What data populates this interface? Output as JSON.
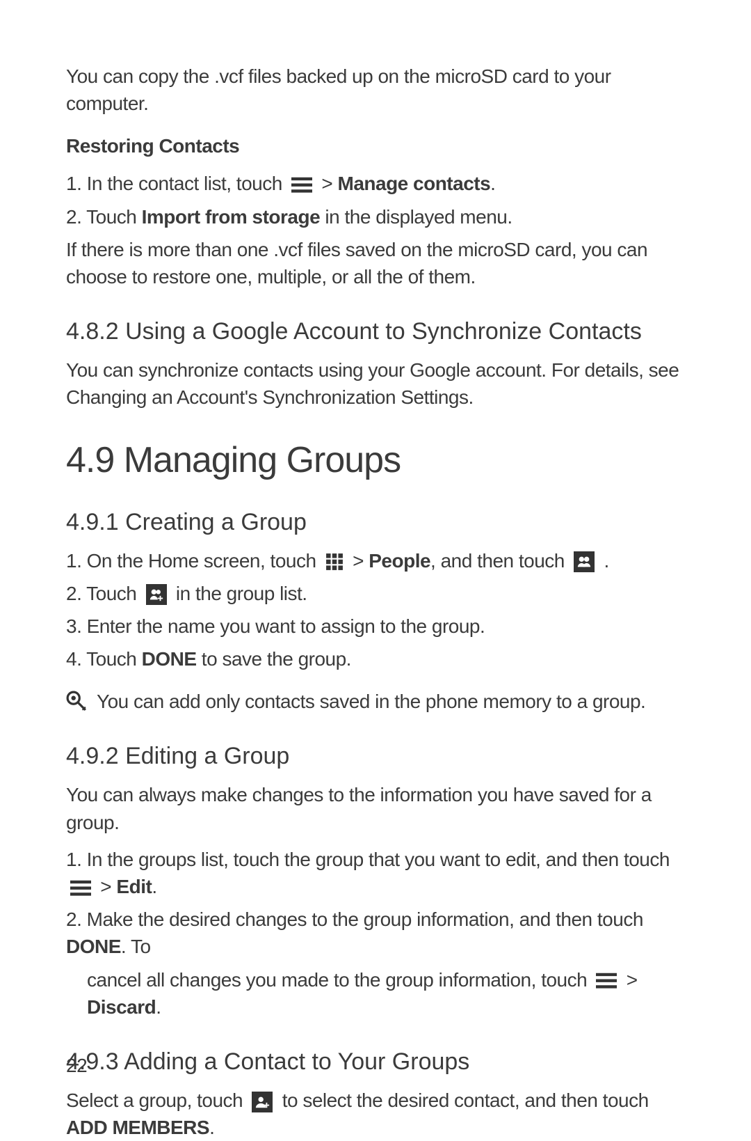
{
  "intro": "You can copy the .vcf files backed up on the microSD card to your computer.",
  "restoring": {
    "heading": "Restoring Contacts",
    "step1_a": "1. In the contact list, touch ",
    "step1_b": " > ",
    "step1_c": "Manage contacts",
    "step1_d": ".",
    "step2_a": "2. Touch ",
    "step2_b": "Import from storage",
    "step2_c": " in the displayed menu.",
    "note": "If there is more than one .vcf files saved on the microSD card, you can choose to restore one, multiple, or all the of them."
  },
  "sec482": {
    "heading": "4.8.2  Using a Google Account to Synchronize Contacts",
    "body": "You can synchronize contacts using your Google account. For details, see Changing an Account's Synchronization Settings."
  },
  "sec49": {
    "heading": "4.9  Managing Groups"
  },
  "sec491": {
    "heading": "4.9.1  Creating a Group",
    "s1_a": "1. On the Home screen, touch ",
    "s1_b": " > ",
    "s1_c": "People",
    "s1_d": ", and then touch ",
    "s1_e": " .",
    "s2_a": "2. Touch ",
    "s2_b": " in the group list.",
    "s3": "3. Enter the name you want to assign to the group.",
    "s4_a": "4. Touch ",
    "s4_b": "DONE",
    "s4_c": " to save the group.",
    "note": "You can add only contacts saved in the phone memory to a group."
  },
  "sec492": {
    "heading": "4.9.2  Editing a Group",
    "intro": "You can always make changes to the information you have saved for a group.",
    "s1_a": "1. In the groups list, touch the group that you want to edit, and then touch ",
    "s1_b": " > ",
    "s1_c": "Edit",
    "s1_d": ".",
    "s2_a": "2. Make the desired changes to the group information, and then touch ",
    "s2_b": "DONE",
    "s2_c": ". To",
    "s2_cont_a": "cancel all changes you made to the group information, touch ",
    "s2_cont_b": " > ",
    "s2_cont_c": "Discard",
    "s2_cont_d": "."
  },
  "sec493": {
    "heading": "4.9.3  Adding a Contact to Your Groups",
    "body_a": "Select a group, touch ",
    "body_b": " to select the desired contact, and then touch ",
    "body_c": "ADD MEMBERS",
    "body_d": "."
  },
  "page_number": "22"
}
